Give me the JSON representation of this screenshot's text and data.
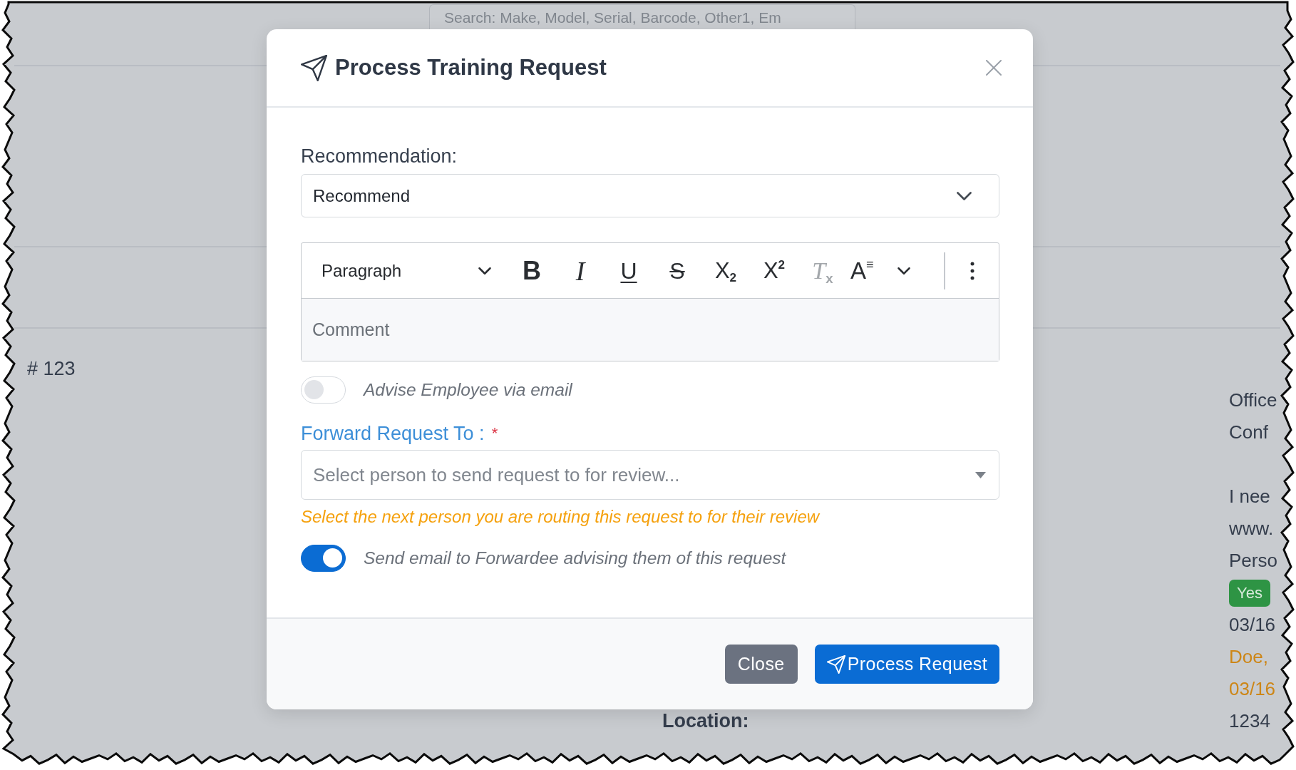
{
  "background_page": {
    "search": {
      "placeholder": "Search: Make, Model, Serial, Barcode, Other1, Em"
    },
    "record_number": "# 123",
    "location_label": "Location:",
    "detail_blocks": [
      {
        "lines": [
          {
            "kind": "text",
            "text": "Office"
          },
          {
            "kind": "text",
            "text": "Conf"
          }
        ]
      },
      {
        "lines": [
          {
            "kind": "text",
            "text": "I nee"
          },
          {
            "kind": "text",
            "text": "www."
          },
          {
            "kind": "text",
            "text": "Perso"
          },
          {
            "kind": "badge",
            "text": "Yes"
          },
          {
            "kind": "text",
            "text": "03/16"
          },
          {
            "kind": "highlight",
            "text": "Doe,"
          },
          {
            "kind": "highlight",
            "text": "03/16"
          },
          {
            "kind": "text",
            "text": "1234"
          }
        ]
      }
    ]
  },
  "dialog": {
    "title": "Process Training Request",
    "recommendation": {
      "label": "Recommendation:",
      "value": "Recommend"
    },
    "editor": {
      "block_style": "Paragraph",
      "tools": [
        {
          "kind": "bold",
          "glyph": "B",
          "disabled": false
        },
        {
          "kind": "italic",
          "glyph": "I",
          "disabled": false
        },
        {
          "kind": "underline",
          "glyph": "U",
          "disabled": false
        },
        {
          "kind": "strikethrough",
          "glyph": "S",
          "disabled": false
        },
        {
          "kind": "subscript",
          "glyph": "X$_{2}$",
          "disabled": false
        },
        {
          "kind": "superscript",
          "glyph": "X$^{2}$",
          "disabled": false
        },
        {
          "kind": "remove-format",
          "glyph": "T$_{x}$",
          "disabled": true
        },
        {
          "kind": "font-size",
          "glyph": "A$^{≡}$",
          "disabled": false
        }
      ],
      "placeholder": "Comment"
    },
    "advise_employee": {
      "label": "Advise Employee via email",
      "on": false
    },
    "forward_to": {
      "label": "Forward Request To :",
      "required_mark": "*",
      "placeholder": "Select person to send request to for review...",
      "hint": "Select the next person you are routing this request to for their review"
    },
    "notify_forwardee": {
      "label": "Send email to Forwardee advising them of this request",
      "on": true
    },
    "buttons": [
      {
        "kind": "secondary",
        "label": "Close"
      },
      {
        "kind": "primary",
        "label": "Process Request"
      }
    ]
  }
}
